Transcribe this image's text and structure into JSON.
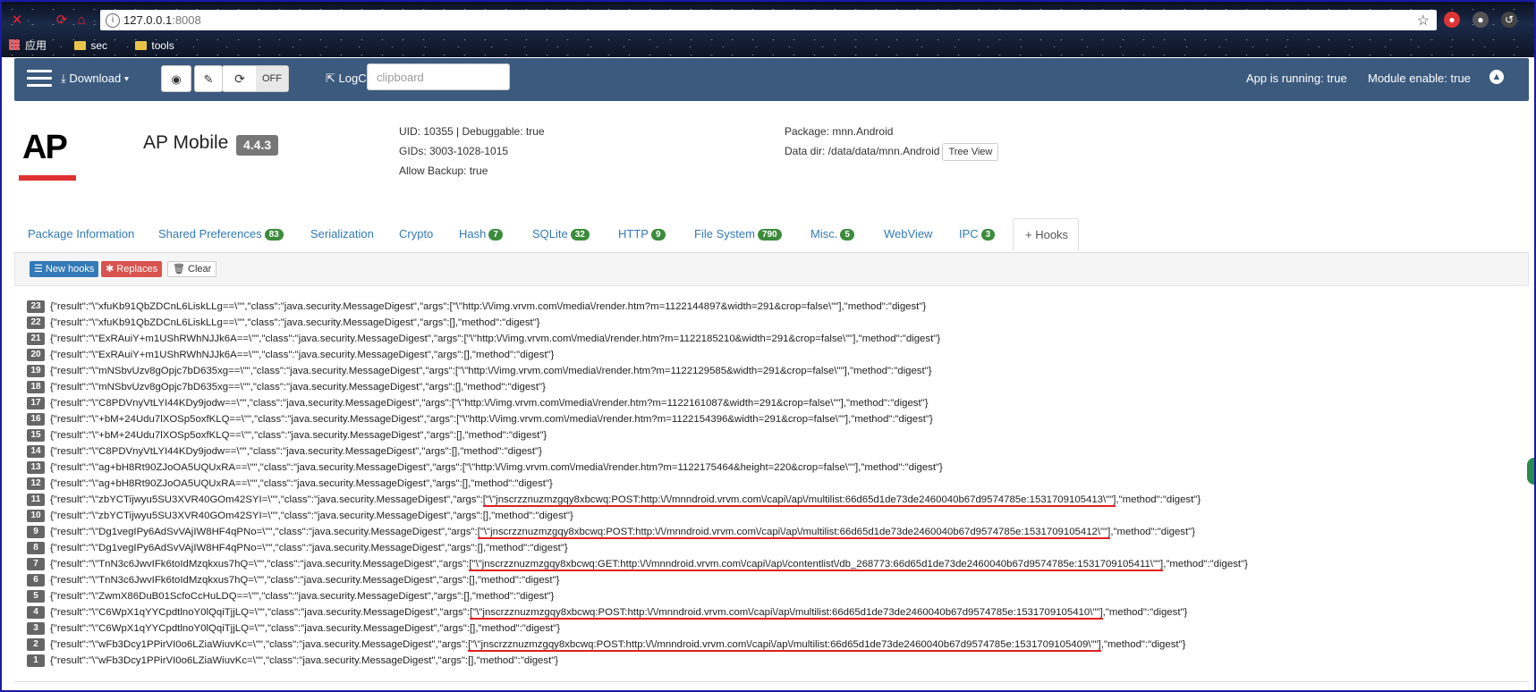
{
  "browser": {
    "url_host": "127.0.0.1",
    "url_port": ":8008",
    "bookmarks": [
      "应用",
      "sec",
      "tools"
    ]
  },
  "navbar": {
    "download": "Download ▾",
    "toggle_state": "OFF",
    "logcat": "LogCat",
    "clipboard_placeholder": "clipboard",
    "app_running": "App is running: true",
    "module_enable": "Module enable: true"
  },
  "app": {
    "logo": "AP",
    "name": "AP Mobile",
    "version": "4.4.3",
    "uid_line": "UID: 10355 | Debuggable: true",
    "gids_line": "GIDs: 3003-1028-1015",
    "backup_line": "Allow Backup: true",
    "package_line": "Package: mnn.Android",
    "datadir_line": "Data dir: /data/data/mnn.Android",
    "tree_view": "Tree View"
  },
  "tabs": [
    {
      "label": "Package Information",
      "badge": ""
    },
    {
      "label": "Shared Preferences",
      "badge": "83"
    },
    {
      "label": "Serialization",
      "badge": ""
    },
    {
      "label": "Crypto",
      "badge": ""
    },
    {
      "label": "Hash",
      "badge": "7"
    },
    {
      "label": "SQLite",
      "badge": "32"
    },
    {
      "label": "HTTP",
      "badge": "9"
    },
    {
      "label": "File System",
      "badge": "790"
    },
    {
      "label": "Misc.",
      "badge": "5"
    },
    {
      "label": "WebView",
      "badge": ""
    },
    {
      "label": "IPC",
      "badge": "3"
    },
    {
      "label": "+ Hooks",
      "badge": ""
    }
  ],
  "panel": {
    "new_hooks": "New hooks",
    "replaces": "Replaces",
    "clear": "Clear"
  },
  "log": [
    {
      "n": "23",
      "pre": "{\"result\":\"\\\"xfuKb91QbZDCnL6LiskLLg==\\\"\",\"class\":\"java.security.MessageDigest\",\"args\":[\"\\\"http:\\/\\/img.vrvm.com\\/media\\/render.htm?m=1122144897&width=291&crop=false\\\"\"],\"method\":\"digest\"}",
      "hl": "",
      "post": ""
    },
    {
      "n": "22",
      "pre": "{\"result\":\"\\\"xfuKb91QbZDCnL6LiskLLg==\\\"\",\"class\":\"java.security.MessageDigest\",\"args\":[],\"method\":\"digest\"}",
      "hl": "",
      "post": ""
    },
    {
      "n": "21",
      "pre": "{\"result\":\"\\\"ExRAuiY+m1UShRWhNJJk6A==\\\"\",\"class\":\"java.security.MessageDigest\",\"args\":[\"\\\"http:\\/\\/img.vrvm.com\\/media\\/render.htm?m=1122185210&width=291&crop=false\\\"\"],\"method\":\"digest\"}",
      "hl": "",
      "post": ""
    },
    {
      "n": "20",
      "pre": "{\"result\":\"\\\"ExRAuiY+m1UShRWhNJJk6A==\\\"\",\"class\":\"java.security.MessageDigest\",\"args\":[],\"method\":\"digest\"}",
      "hl": "",
      "post": ""
    },
    {
      "n": "19",
      "pre": "{\"result\":\"\\\"mNSbvUzv8gOpjc7bD635xg==\\\"\",\"class\":\"java.security.MessageDigest\",\"args\":[\"\\\"http:\\/\\/img.vrvm.com\\/media\\/render.htm?m=1122129585&width=291&crop=false\\\"\"],\"method\":\"digest\"}",
      "hl": "",
      "post": ""
    },
    {
      "n": "18",
      "pre": "{\"result\":\"\\\"mNSbvUzv8gOpjc7bD635xg==\\\"\",\"class\":\"java.security.MessageDigest\",\"args\":[],\"method\":\"digest\"}",
      "hl": "",
      "post": ""
    },
    {
      "n": "17",
      "pre": "{\"result\":\"\\\"C8PDVnyVtLYI44KDy9jodw==\\\"\",\"class\":\"java.security.MessageDigest\",\"args\":[\"\\\"http:\\/\\/img.vrvm.com\\/media\\/render.htm?m=1122161087&width=291&crop=false\\\"\"],\"method\":\"digest\"}",
      "hl": "",
      "post": ""
    },
    {
      "n": "16",
      "pre": "{\"result\":\"\\\"+bM+24Udu7lXOSp5oxfKLQ==\\\"\",\"class\":\"java.security.MessageDigest\",\"args\":[\"\\\"http:\\/\\/img.vrvm.com\\/media\\/render.htm?m=1122154396&width=291&crop=false\\\"\"],\"method\":\"digest\"}",
      "hl": "",
      "post": ""
    },
    {
      "n": "15",
      "pre": "{\"result\":\"\\\"+bM+24Udu7lXOSp5oxfKLQ==\\\"\",\"class\":\"java.security.MessageDigest\",\"args\":[],\"method\":\"digest\"}",
      "hl": "",
      "post": ""
    },
    {
      "n": "14",
      "pre": "{\"result\":\"\\\"C8PDVnyVtLYI44KDy9jodw==\\\"\",\"class\":\"java.security.MessageDigest\",\"args\":[],\"method\":\"digest\"}",
      "hl": "",
      "post": ""
    },
    {
      "n": "13",
      "pre": "{\"result\":\"\\\"ag+bH8Rt90ZJoOA5UQUxRA==\\\"\",\"class\":\"java.security.MessageDigest\",\"args\":[\"\\\"http:\\/\\/img.vrvm.com\\/media\\/render.htm?m=1122175464&height=220&crop=false\\\"\"],\"method\":\"digest\"}",
      "hl": "",
      "post": ""
    },
    {
      "n": "12",
      "pre": "{\"result\":\"\\\"ag+bH8Rt90ZJoOA5UQUxRA==\\\"\",\"class\":\"java.security.MessageDigest\",\"args\":[],\"method\":\"digest\"}",
      "hl": "",
      "post": ""
    },
    {
      "n": "11",
      "pre": "{\"result\":\"\\\"zbYCTijwyu5SU3XVR40GOm42SYI=\\\"\",\"class\":\"java.security.MessageDigest\",\"args\":",
      "hl": "[\"\\\"jnscrzznuzmzgqy8xbcwq:POST:http:\\/\\/mnndroid.vrvm.com\\/capi\\/ap\\/multilist:66d65d1de73de2460040b67d9574785e:1531709105413\\\"\"]",
      "post": ",\"method\":\"digest\"}"
    },
    {
      "n": "10",
      "pre": "{\"result\":\"\\\"zbYCTijwyu5SU3XVR40GOm42SYI=\\\"\",\"class\":\"java.security.MessageDigest\",\"args\":[],\"method\":\"digest\"}",
      "hl": "",
      "post": ""
    },
    {
      "n": "9",
      "pre": "{\"result\":\"\\\"Dg1vegIPy6AdSvVAjIW8HF4qPNo=\\\"\",\"class\":\"java.security.MessageDigest\",\"args\":",
      "hl": "[\"\\\"jnscrzznuzmzgqy8xbcwq:POST:http:\\/\\/mnndroid.vrvm.com\\/capi\\/ap\\/multilist:66d65d1de73de2460040b67d9574785e:1531709105412\\\"\"]",
      "post": ",\"method\":\"digest\"}"
    },
    {
      "n": "8",
      "pre": "{\"result\":\"\\\"Dg1vegIPy6AdSvVAjIW8HF4qPNo=\\\"\",\"class\":\"java.security.MessageDigest\",\"args\":[],\"method\":\"digest\"}",
      "hl": "",
      "post": ""
    },
    {
      "n": "7",
      "pre": "{\"result\":\"\\\"TnN3c6JwvIFk6toIdMzqkxus7hQ=\\\"\",\"class\":\"java.security.MessageDigest\",\"args\":",
      "hl": "[\"\\\"jnscrzznuzmzgqy8xbcwq:GET:http:\\/\\/mnndroid.vrvm.com\\/capi\\/ap\\/contentlist\\/db_268773:66d65d1de73de2460040b67d9574785e:1531709105411\\\"\"]",
      "post": ",\"method\":\"digest\"}"
    },
    {
      "n": "6",
      "pre": "{\"result\":\"\\\"TnN3c6JwvIFk6toIdMzqkxus7hQ=\\\"\",\"class\":\"java.security.MessageDigest\",\"args\":[],\"method\":\"digest\"}",
      "hl": "",
      "post": ""
    },
    {
      "n": "5",
      "pre": "{\"result\":\"\\\"ZwmX86DuB01ScfoCcHuLDQ==\\\"\",\"class\":\"java.security.MessageDigest\",\"args\":[],\"method\":\"digest\"}",
      "hl": "",
      "post": ""
    },
    {
      "n": "4",
      "pre": "{\"result\":\"\\\"C6WpX1qYYCpdtlnoY0lQqiTjjLQ=\\\"\",\"class\":\"java.security.MessageDigest\",\"args\":",
      "hl": "[\"\\\"jnscrzznuzmzgqy8xbcwq:POST:http:\\/\\/mnndroid.vrvm.com\\/capi\\/ap\\/multilist:66d65d1de73de2460040b67d9574785e:1531709105410\\\"\"]",
      "post": ",\"method\":\"digest\"}"
    },
    {
      "n": "3",
      "pre": "{\"result\":\"\\\"C6WpX1qYYCpdtlnoY0lQqiTjjLQ=\\\"\",\"class\":\"java.security.MessageDigest\",\"args\":[],\"method\":\"digest\"}",
      "hl": "",
      "post": ""
    },
    {
      "n": "2",
      "pre": "{\"result\":\"\\\"wFb3Dcy1PPirVI0o6LZiaWiuvKc=\\\"\",\"class\":\"java.security.MessageDigest\",\"args\":",
      "hl": "[\"\\\"jnscrzznuzmzgqy8xbcwq:POST:http:\\/\\/mnndroid.vrvm.com\\/capi\\/ap\\/multilist:66d65d1de73de2460040b67d9574785e:1531709105409\\\"\"]",
      "post": ",\"method\":\"digest\"}"
    },
    {
      "n": "1",
      "pre": "{\"result\":\"\\\"wFb3Dcy1PPirVI0o6LZiaWiuvKc=\\\"\",\"class\":\"java.security.MessageDigest\",\"args\":[],\"method\":\"digest\"}",
      "hl": "",
      "post": ""
    }
  ]
}
